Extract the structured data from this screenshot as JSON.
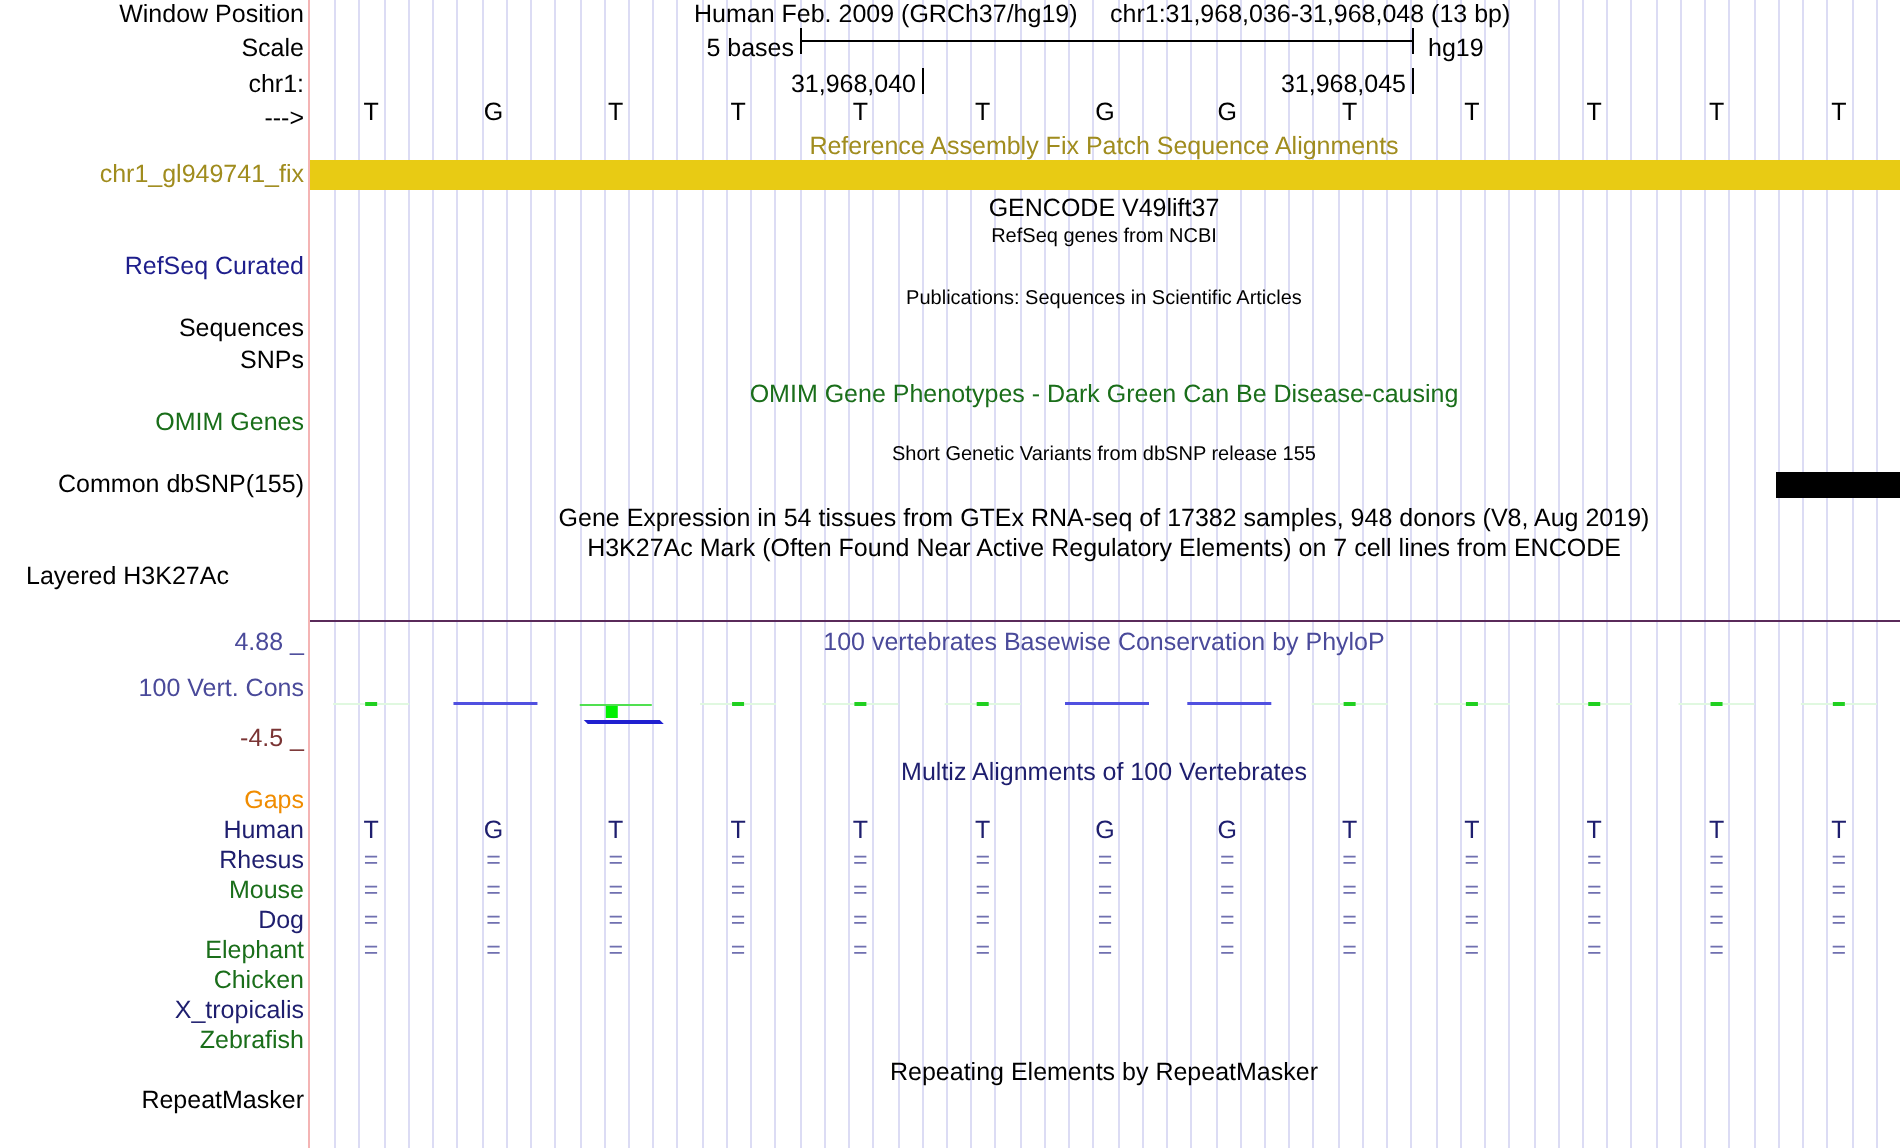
{
  "header": {
    "assembly": "Human Feb. 2009 (GRCh37/hg19)",
    "position": "chr1:31,968,036-31,968,048 (13 bp)"
  },
  "scale": {
    "span": "5 bases",
    "build": "hg19",
    "ticks": [
      "31,968,040",
      "31,968,045"
    ]
  },
  "bases": [
    "T",
    "G",
    "T",
    "T",
    "T",
    "T",
    "G",
    "G",
    "T",
    "T",
    "T",
    "T",
    "T"
  ],
  "labels": [
    {
      "text": "Window Position",
      "color": "#000000"
    },
    {
      "text": "Scale",
      "color": "#000000"
    },
    {
      "text": "chr1:",
      "color": "#000000"
    },
    {
      "text": "--->",
      "color": "#000000"
    },
    {
      "text": "chr1_gl949741_fix",
      "color": "#a08c1e"
    },
    {
      "text": "RefSeq Curated",
      "color": "#1e1e8c"
    },
    {
      "text": "Sequences",
      "color": "#000000"
    },
    {
      "text": "SNPs",
      "color": "#000000"
    },
    {
      "text": "OMIM Genes",
      "color": "#1a6e1a"
    },
    {
      "text": "Common dbSNP(155)",
      "color": "#000000"
    },
    {
      "text": "Layered H3K27Ac",
      "color": "#000000"
    },
    {
      "text": "4.88 _",
      "color": "#4a4a9a"
    },
    {
      "text": "100 Vert. Cons",
      "color": "#4a4a9a"
    },
    {
      "text": "-4.5 _",
      "color": "#7a3434"
    },
    {
      "text": "Gaps",
      "color": "#f08c00"
    }
  ],
  "titles": [
    {
      "text": "Reference Assembly Fix Patch Sequence Alignments",
      "color": "#a08c1e"
    },
    {
      "text": "GENCODE V49lift37",
      "color": "#000000"
    },
    {
      "text": "RefSeq genes from NCBI",
      "color": "#000000"
    },
    {
      "text": "Publications: Sequences in Scientific Articles",
      "color": "#000000"
    },
    {
      "text": "OMIM Gene Phenotypes - Dark Green Can Be Disease-causing",
      "color": "#1a6e1a"
    },
    {
      "text": "Short Genetic Variants from dbSNP release 155",
      "color": "#000000"
    },
    {
      "text": "Gene Expression in 54 tissues from GTEx RNA-seq of 17382 samples, 948 donors (V8, Aug 2019)",
      "color": "#000000"
    },
    {
      "text": "H3K27Ac Mark (Often Found Near Active Regulatory Elements) on 7 cell lines from ENCODE",
      "color": "#000000"
    },
    {
      "text": "100 vertebrates Basewise Conservation by PhyloP",
      "color": "#4a4a9a"
    },
    {
      "text": "Multiz Alignments of 100 Vertebrates",
      "color": "#1e1e6e"
    }
  ],
  "species": [
    {
      "name": "Human",
      "color": "#1e1e6e",
      "row": [
        "T",
        "G",
        "T",
        "T",
        "T",
        "T",
        "G",
        "G",
        "T",
        "T",
        "T",
        "T",
        "T"
      ]
    },
    {
      "name": "Rhesus",
      "color": "#1e1e6e",
      "row": [
        "=",
        "=",
        "=",
        "=",
        "=",
        "=",
        "=",
        "=",
        "=",
        "=",
        "=",
        "=",
        "="
      ]
    },
    {
      "name": "Mouse",
      "color": "#1a6e1a",
      "row": [
        "=",
        "=",
        "=",
        "=",
        "=",
        "=",
        "=",
        "=",
        "=",
        "=",
        "=",
        "=",
        "="
      ]
    },
    {
      "name": "Dog",
      "color": "#1e1e6e",
      "row": [
        "=",
        "=",
        "=",
        "=",
        "=",
        "=",
        "=",
        "=",
        "=",
        "=",
        "=",
        "=",
        "="
      ]
    },
    {
      "name": "Elephant",
      "color": "#1a6e1a",
      "row": [
        "=",
        "=",
        "=",
        "=",
        "=",
        "=",
        "=",
        "=",
        "=",
        "=",
        "=",
        "=",
        "="
      ]
    },
    {
      "name": "Chicken",
      "color": "#1a6e1a"
    },
    {
      "name": "X_tropicalis",
      "color": "#1e1e6e"
    },
    {
      "name": "Zebrafish",
      "color": "#1a6e1a"
    }
  ],
  "repeats": {
    "title": "Repeating Elements by RepeatMasker",
    "label": "RepeatMasker"
  }
}
